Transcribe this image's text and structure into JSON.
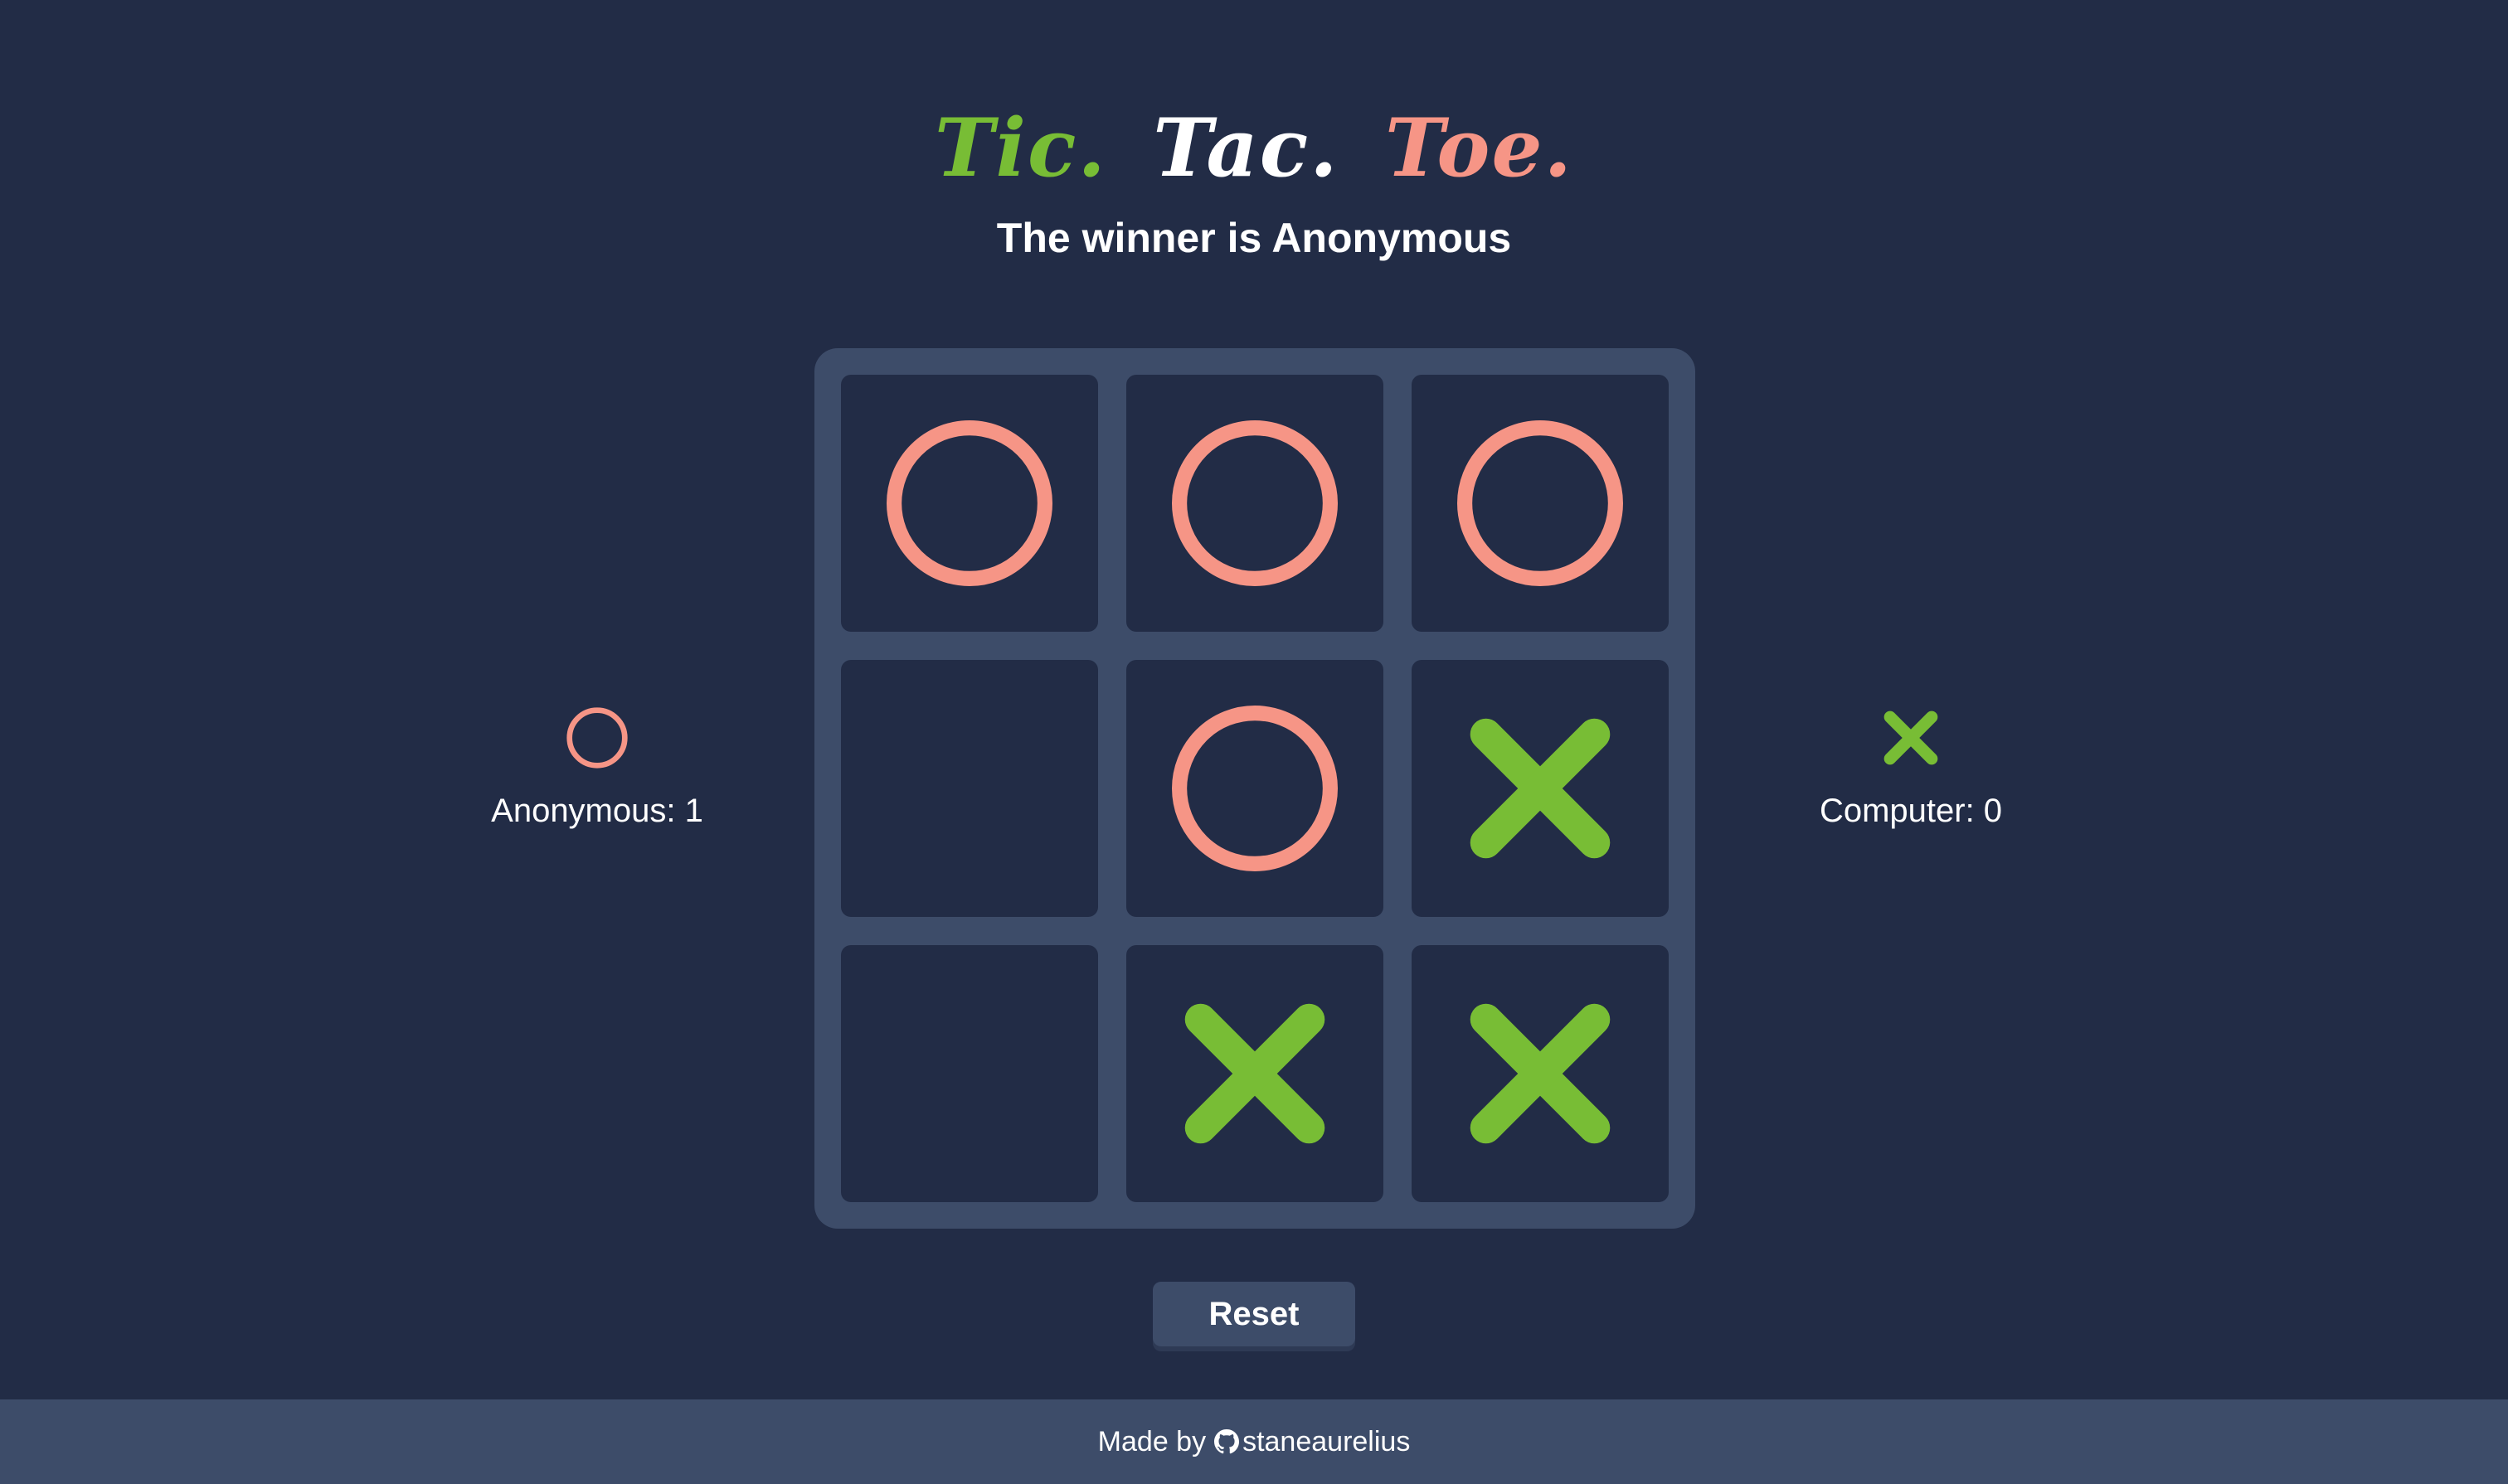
{
  "title": {
    "words": [
      {
        "text": "Tic.",
        "color": "#78bd35"
      },
      {
        "text": "Tac.",
        "color": "#ffffff"
      },
      {
        "text": "Toe.",
        "color": "#f69586"
      }
    ]
  },
  "status": {
    "text": "The winner is Anonymous"
  },
  "board": {
    "cells": [
      "O",
      "O",
      "O",
      "",
      "O",
      "X",
      "",
      "X",
      "X"
    ]
  },
  "players": {
    "left": {
      "symbol": "O",
      "label": "Anonymous: 1"
    },
    "right": {
      "symbol": "X",
      "label": "Computer: 0"
    }
  },
  "reset_label": "Reset",
  "footer": {
    "prefix": "Made by",
    "author": "staneaurelius",
    "author_icon": "github-icon"
  },
  "colors": {
    "background": "#222c46",
    "board": "#3d4c69",
    "o_mark": "#f69586",
    "x_mark": "#78bd35",
    "text": "#ffffff"
  }
}
